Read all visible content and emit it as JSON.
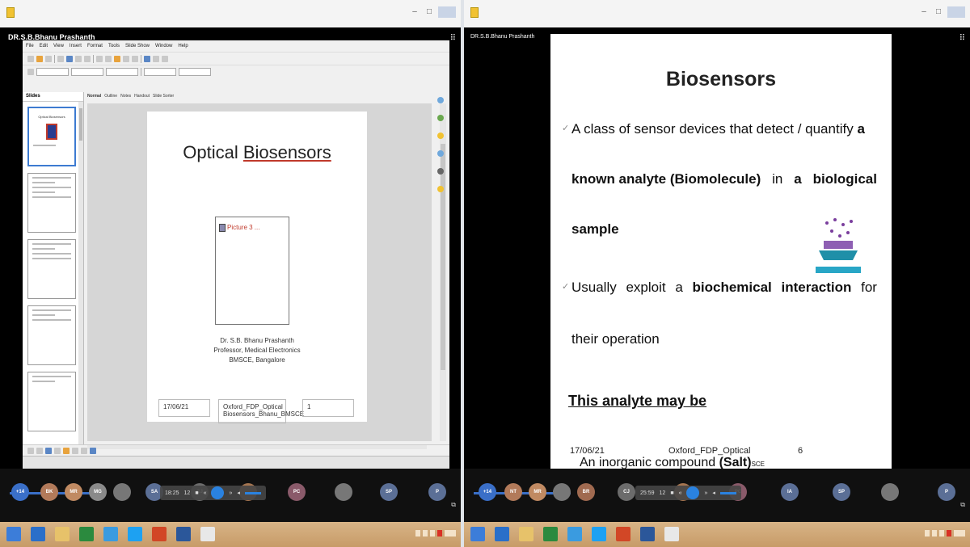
{
  "colors": {
    "accent": "#3a6fc8",
    "taskbar": "#c79b68",
    "highlight_red": "#c0392b"
  },
  "left": {
    "presenter": "DR.S.B.Bhanu Prashanth",
    "menu": [
      "File",
      "Edit",
      "View",
      "Insert",
      "Format",
      "Tools",
      "Slide Show",
      "Window",
      "Help"
    ],
    "slides_panel_title": "Slides",
    "view_tabs": [
      "Normal",
      "Outline",
      "Notes",
      "Handout",
      "Slide Sorter"
    ],
    "slide": {
      "title_prefix": "Optical ",
      "title_word": "Biosensors",
      "picture_label": "Picture 3 ...",
      "author_lines": [
        "Dr. S.B. Bhanu Prashanth",
        "Professor, Medical Electronics",
        "BMSCE, Bangalore"
      ],
      "footer_date": "17/06/21",
      "footer_mid": "Oxford_FDP_Optical Biosensors_Bhanu_BMSCE",
      "footer_page": "1"
    },
    "thumb_title": "Optical Biosensors",
    "meeting": {
      "count": "+14",
      "avatars": [
        "BK",
        "MR",
        "MG",
        "",
        "SA",
        "CJ",
        "",
        "PC",
        "",
        "SP",
        "P"
      ],
      "time": "18:25",
      "count2": "12"
    }
  },
  "right": {
    "presenter": "DR.S.B.Bhanu Prashanth",
    "slide": {
      "title": "Biosensors",
      "b1_line1_normal": "A class of sensor devices that detect / quantify",
      "b1_line1_bold": "a",
      "b1_line2_a": "known analyte (Biomolecule)",
      "b1_line2_b": "in",
      "b1_line2_c": "a",
      "b1_line2_d": "biological",
      "b1_line3": "sample",
      "b2_a": "Usually",
      "b2_b": "exploit",
      "b2_c": "a",
      "b2_d": "biochemical",
      "b2_e": "interaction",
      "b2_f": "for",
      "b2_line2": "their operation",
      "analyte_head": "This analyte may be",
      "footer_date": "17/06/21",
      "footer_mid": "Oxford_FDP_Optical",
      "footer_page": "6",
      "next_item_prefix": "An inorganic compound",
      "next_item_bold": "(Salt)",
      "next_item_suffix": "SCE"
    },
    "meeting": {
      "count": "+14",
      "avatars": [
        "NT",
        "MR",
        "",
        "BR",
        "CJ",
        "",
        "PC",
        "IA",
        "SP",
        "",
        "P"
      ],
      "time": "25:59",
      "count2": "12"
    }
  }
}
